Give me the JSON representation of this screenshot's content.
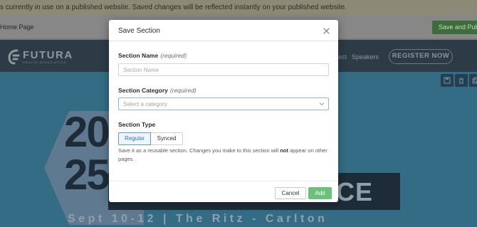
{
  "notice": {
    "text": "s currently in use on a published website. Saved changes will be reflected instantly on your published website."
  },
  "editor": {
    "page_name": "Home Page",
    "save_publish_label": "Save and Publi"
  },
  "site": {
    "logo_name": "FUTURA",
    "logo_subtitle": "HEALTH ASSOCIATION",
    "nav": [
      "ect",
      "Speakers"
    ],
    "register_label": "REGISTER NOW",
    "year_top": "20",
    "year_bottom": "25",
    "conference_text": "CE",
    "event_date": "Sept 10-12 | The Ritz - Carlton",
    "tool_icons": [
      "save-icon",
      "trash-icon",
      "copy-icon"
    ]
  },
  "modal": {
    "title": "Save Section",
    "section_name": {
      "label": "Section Name",
      "required": "(required)",
      "placeholder": "Section Name",
      "value": ""
    },
    "section_category": {
      "label": "Section Category",
      "required": "(required)",
      "placeholder": "Select a category"
    },
    "section_type": {
      "label": "Section Type",
      "options": [
        "Regular",
        "Synced"
      ],
      "selected": "Regular",
      "help_before": "Save it as a reusable section. Changes you make to this section will ",
      "help_bold": "not",
      "help_after": " appear on other pages."
    },
    "cancel_label": "Cancel",
    "add_label": "Add",
    "colors": {
      "accent": "#5b9bd6",
      "add_button": "#6cc17a"
    }
  }
}
